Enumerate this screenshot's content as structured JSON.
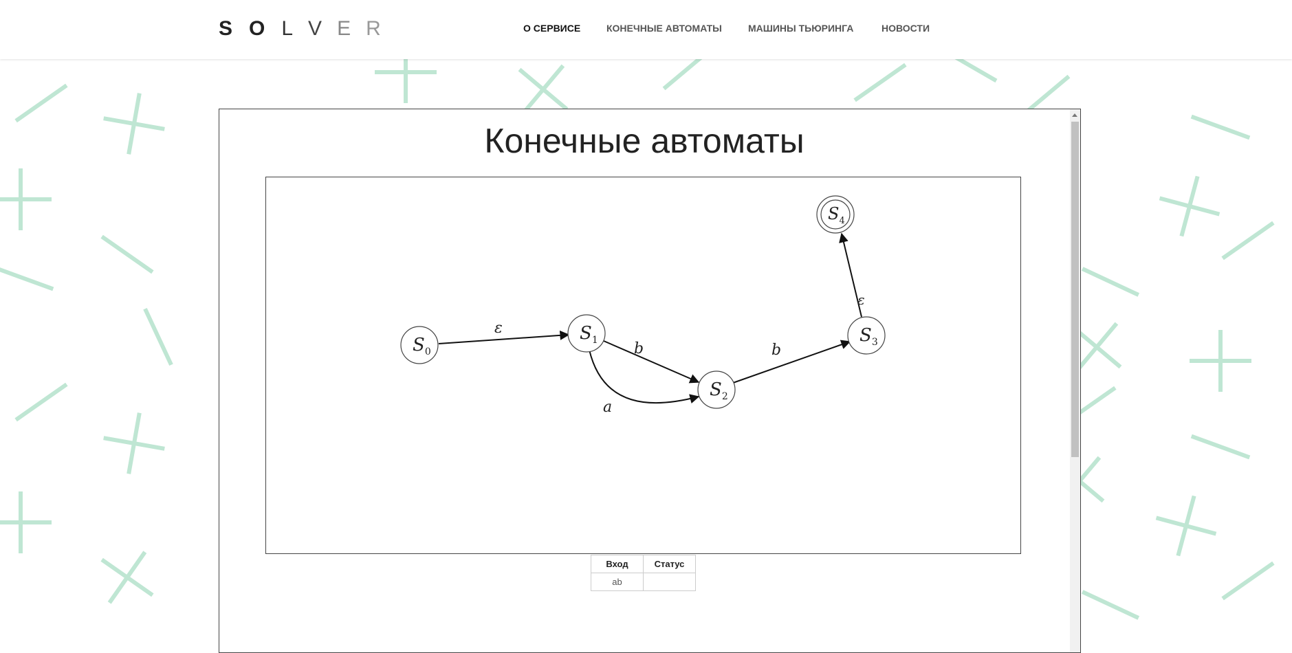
{
  "logo": {
    "letters": [
      "S",
      "O",
      "L",
      "V",
      "E",
      "R"
    ]
  },
  "nav": [
    {
      "label": "О СЕРВИСЕ",
      "active": true
    },
    {
      "label": "КОНЕЧНЫЕ АВТОМАТЫ",
      "active": false
    },
    {
      "label": "МАШИНЫ ТЬЮРИНГА",
      "active": false
    },
    {
      "label": "НОВОСТИ",
      "active": false
    }
  ],
  "page": {
    "title": "Конечные автоматы"
  },
  "automaton": {
    "states": [
      {
        "name": "S",
        "index": "0",
        "accepting": false
      },
      {
        "name": "S",
        "index": "1",
        "accepting": false
      },
      {
        "name": "S",
        "index": "2",
        "accepting": false
      },
      {
        "name": "S",
        "index": "3",
        "accepting": false
      },
      {
        "name": "S",
        "index": "4",
        "accepting": true
      }
    ],
    "transitions": [
      {
        "from": "0",
        "to": "1",
        "label": "ε"
      },
      {
        "from": "1",
        "to": "2",
        "label": "b"
      },
      {
        "from": "1",
        "to": "2",
        "label": "a"
      },
      {
        "from": "2",
        "to": "3",
        "label": "b"
      },
      {
        "from": "3",
        "to": "4",
        "label": "ε"
      }
    ]
  },
  "table": {
    "headers": [
      "Вход",
      "Статус"
    ],
    "rows": [
      [
        "ab",
        ""
      ]
    ]
  },
  "colors": {
    "background_pattern": "#bfe6d3",
    "text": "#222222",
    "border": "#444444"
  }
}
